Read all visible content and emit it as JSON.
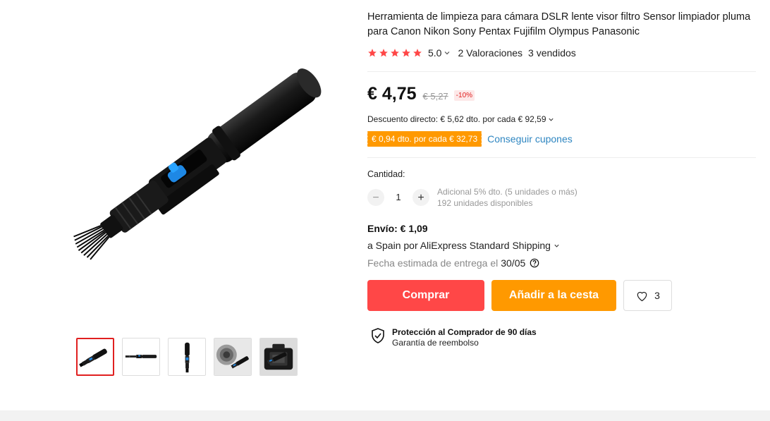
{
  "product": {
    "title": "Herramienta de limpieza para cámara DSLR lente visor filtro Sensor limpiador pluma para Canon Nikon Sony Pentax Fujifilm Olympus Panasonic",
    "rating": "5.0",
    "rating_stars": 5,
    "reviews": "2 Valoraciones",
    "sold": "3 vendidos"
  },
  "pricing": {
    "price": "€ 4,75",
    "old_price": "€ 5,27",
    "discount": "-10%",
    "direct_discount": "Descuento directo: € 5,62 dto. por cada € 92,59",
    "coupon": "€ 0,94 dto. por cada € 32,73",
    "coupon_link": "Conseguir cupones"
  },
  "quantity": {
    "label": "Cantidad:",
    "minus": "−",
    "value": "1",
    "plus": "+",
    "extra_discount": "Adicional 5% dto. (5 unidades o más)",
    "available": "192 unidades disponibles"
  },
  "shipping": {
    "cost": "Envío: € 1,09",
    "route": "a Spain por AliExpress Standard Shipping",
    "delivery_label": "Fecha estimada de entrega el",
    "delivery_date": "30/05"
  },
  "actions": {
    "buy": "Comprar",
    "add_to_cart": "Añadir a la cesta",
    "wishlist_count": "3"
  },
  "protection": {
    "title": "Protección al Comprador de 90 días",
    "subtitle": "Garantía de reembolso"
  },
  "gallery": {
    "thumbnails": [
      "pen-diagonal",
      "pen-horizontal",
      "pen-vertical",
      "lens-cleaning",
      "camera-cleaning"
    ],
    "active_thumbnail": 0
  },
  "colors": {
    "star": "#ff4747",
    "buy": "#ff4747",
    "cart": "#ff9900",
    "coupon": "#ff9900",
    "link": "#2e86c1",
    "discount": "#e02020"
  }
}
